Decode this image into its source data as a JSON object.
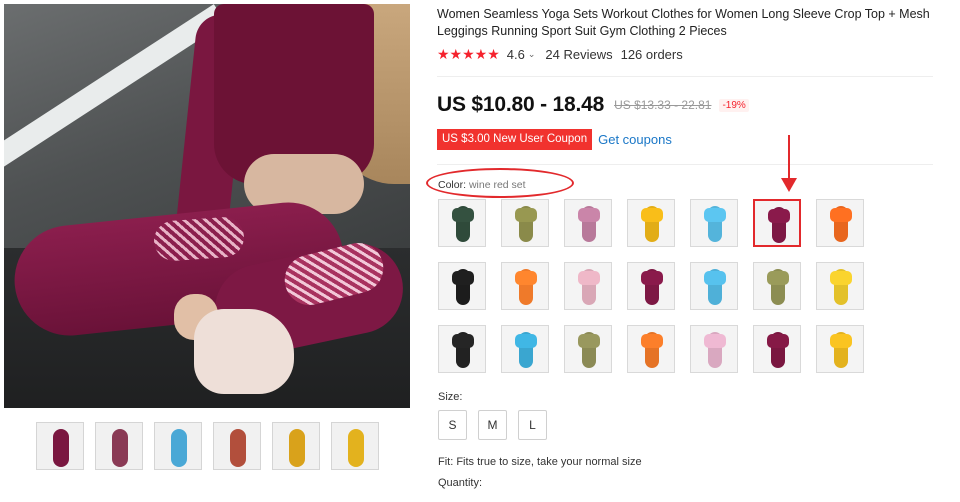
{
  "product": {
    "title": "Women Seamless Yoga Sets Workout Clothes for Women Long Sleeve Crop Top + Mesh Leggings Running Sport Suit Gym Clothing 2 Pieces",
    "rating_stars": "★★★★★",
    "rating_value": "4.6",
    "rating_chevron": "⌄",
    "reviews": "24 Reviews",
    "orders": "126 orders",
    "price": "US $10.80 - 18.48",
    "old_price": "US $13.33 - 22.81",
    "discount": "-19%",
    "coupon": "US $3.00 New User Coupon",
    "get_coupons": "Get coupons",
    "color_label": "Color:",
    "color_value": "wine red set",
    "size_label": "Size:",
    "sizes": [
      "S",
      "M",
      "L"
    ],
    "fit_text": "Fit: Fits true to size, take your normal size",
    "quantity_label": "Quantity:"
  },
  "colors": {
    "accent_red": "#e2292c",
    "link_blue": "#1a77c7",
    "coupon_red": "#f1322e"
  },
  "gallery_thumbs": [
    {
      "name": "wine",
      "color": "#7a1740"
    },
    {
      "name": "wine-duo",
      "color": "#8a3a55"
    },
    {
      "name": "blue",
      "color": "#4aa8d6"
    },
    {
      "name": "multi",
      "color": "#b24f3c"
    },
    {
      "name": "yellow-duo",
      "color": "#d9a21b"
    },
    {
      "name": "yellow",
      "color": "#e3b21e"
    }
  ],
  "color_swatches": [
    {
      "name": "green-black",
      "color": "#2f4a3a",
      "selected": false
    },
    {
      "name": "olive",
      "color": "#8a8a4a",
      "selected": false
    },
    {
      "name": "pink-purple",
      "color": "#b8799a",
      "selected": false
    },
    {
      "name": "yellow",
      "color": "#e2ad17",
      "selected": false
    },
    {
      "name": "light-blue",
      "color": "#54b4db",
      "selected": false
    },
    {
      "name": "wine-red",
      "color": "#7d1844",
      "selected": true
    },
    {
      "name": "orange",
      "color": "#e8661e",
      "selected": false
    },
    {
      "name": "black-leggings",
      "color": "#1c1c1c",
      "selected": false
    },
    {
      "name": "orange-leggings",
      "color": "#ef7a2a",
      "selected": false
    },
    {
      "name": "pink-leggings",
      "color": "#d9a7b6",
      "selected": false
    },
    {
      "name": "wine-leggings",
      "color": "#7d1844",
      "selected": false
    },
    {
      "name": "blue-leggings",
      "color": "#4fb0d8",
      "selected": false
    },
    {
      "name": "olive-leggings",
      "color": "#8c8d52",
      "selected": false
    },
    {
      "name": "yellow-leggings",
      "color": "#e3c12a",
      "selected": false
    },
    {
      "name": "black-top",
      "color": "#222222",
      "selected": false
    },
    {
      "name": "blue-top",
      "color": "#3aa6d0",
      "selected": false
    },
    {
      "name": "olive-top",
      "color": "#8b8a55",
      "selected": false
    },
    {
      "name": "orange-top",
      "color": "#e57326",
      "selected": false
    },
    {
      "name": "pink-top",
      "color": "#d9a8c0",
      "selected": false
    },
    {
      "name": "wine-top",
      "color": "#7a1740",
      "selected": false
    },
    {
      "name": "yellow-top",
      "color": "#e3b21e",
      "selected": false
    }
  ]
}
